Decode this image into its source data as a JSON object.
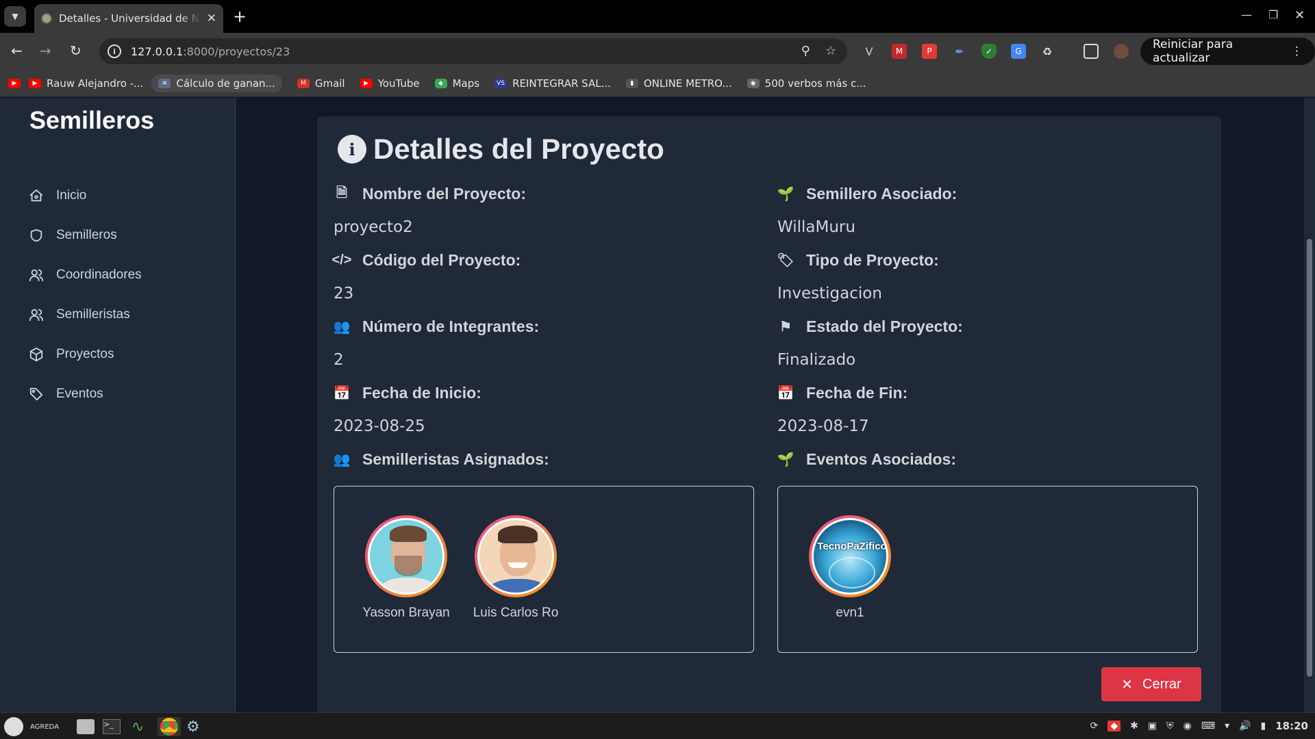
{
  "browser": {
    "tab_title": "Detalles - Universidad de Nariño",
    "url_host": "127.0.0.1",
    "url_path": ":8000/proyectos/23",
    "relaunch_label": "Reiniciar para actualizar",
    "bookmarks": [
      {
        "label": "",
        "icon": "youtube-icon",
        "color": "#ff0000"
      },
      {
        "label": "Rauw Alejandro -...",
        "icon": "youtube-icon",
        "color": "#ff0000"
      },
      {
        "label": "Cálculo de ganan...",
        "icon": "chart-icon",
        "color": "#5a6b8c"
      },
      {
        "label": "Gmail",
        "icon": "gmail-icon",
        "color": "#d93025"
      },
      {
        "label": "YouTube",
        "icon": "youtube-icon",
        "color": "#ff0000"
      },
      {
        "label": "Maps",
        "icon": "maps-icon",
        "color": "#34a853"
      },
      {
        "label": "REINTEGRAR SAL...",
        "icon": "vs-icon",
        "color": "#2b3a8c"
      },
      {
        "label": "ONLINE METRO...",
        "icon": "bar-chart-icon",
        "color": "#555555"
      },
      {
        "label": "500 verbos más c...",
        "icon": "globe-icon",
        "color": "#666666"
      }
    ]
  },
  "sidebar": {
    "brand": "Semilleros",
    "items": [
      {
        "label": "Inicio",
        "icon": "home-icon"
      },
      {
        "label": "Semilleros",
        "icon": "shield-icon"
      },
      {
        "label": "Coordinadores",
        "icon": "user-icon"
      },
      {
        "label": "Semilleristas",
        "icon": "user-icon"
      },
      {
        "label": "Proyectos",
        "icon": "cube-icon"
      },
      {
        "label": "Eventos",
        "icon": "tag-icon"
      }
    ]
  },
  "card": {
    "title": "Detalles del Proyecto",
    "fields": {
      "nombre_label": "Nombre del Proyecto:",
      "nombre_value": "proyecto2",
      "semillero_label": "Semillero Asociado:",
      "semillero_value": "WillaMuru",
      "codigo_label": "Código del Proyecto:",
      "codigo_value": "23",
      "tipo_label": "Tipo de Proyecto:",
      "tipo_value": "Investigacion",
      "integrantes_label": "Número de Integrantes:",
      "integrantes_value": "2",
      "estado_label": "Estado del Proyecto:",
      "estado_value": "Finalizado",
      "inicio_label": "Fecha de Inicio:",
      "inicio_value": "2023-08-25",
      "fin_label": "Fecha de Fin:",
      "fin_value": "2023-08-17",
      "semilleristas_label": "Semilleristas Asignados:",
      "eventos_label": "Eventos Asociados:"
    },
    "semilleristas": [
      {
        "name": "Yasson Brayan"
      },
      {
        "name": "Luis Carlos Ro"
      }
    ],
    "eventos": [
      {
        "name": "evn1",
        "logo_text": "TecnoPaZifico"
      }
    ],
    "close_label": "Cerrar"
  },
  "taskbar": {
    "user_label": "AGREDA",
    "clock": "18:20"
  }
}
